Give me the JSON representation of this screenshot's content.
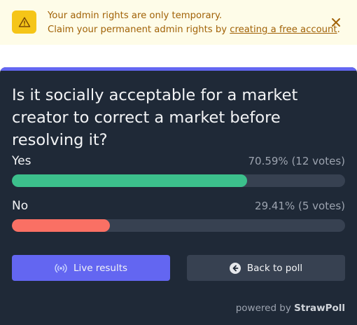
{
  "banner": {
    "line1": "Your admin rights are only temporary.",
    "line2_prefix": "Claim your permanent admin rights by ",
    "link": "creating a free account",
    "line2_suffix": ".",
    "icons": {
      "warning": "warning-triangle-icon",
      "close": "close-icon"
    }
  },
  "poll": {
    "question": "Is it socially acceptable for a market creator to correct a market before resolving it?",
    "options": [
      {
        "label": "Yes",
        "stat": "70.59% (12 votes)",
        "percent": 70.59,
        "votes": 12,
        "color": "#3cc08c"
      },
      {
        "label": "No",
        "stat": "29.41% (5 votes)",
        "percent": 29.41,
        "votes": 5,
        "color": "#fa7064"
      }
    ]
  },
  "buttons": {
    "live": "Live results",
    "back": "Back to poll"
  },
  "footer": {
    "powered_prefix": "powered by ",
    "brand": "StrawPoll"
  },
  "colors": {
    "banner_bg": "#fefce8",
    "banner_text": "#a16207",
    "accent": "#6366f1",
    "card_bg": "#1f2937"
  }
}
